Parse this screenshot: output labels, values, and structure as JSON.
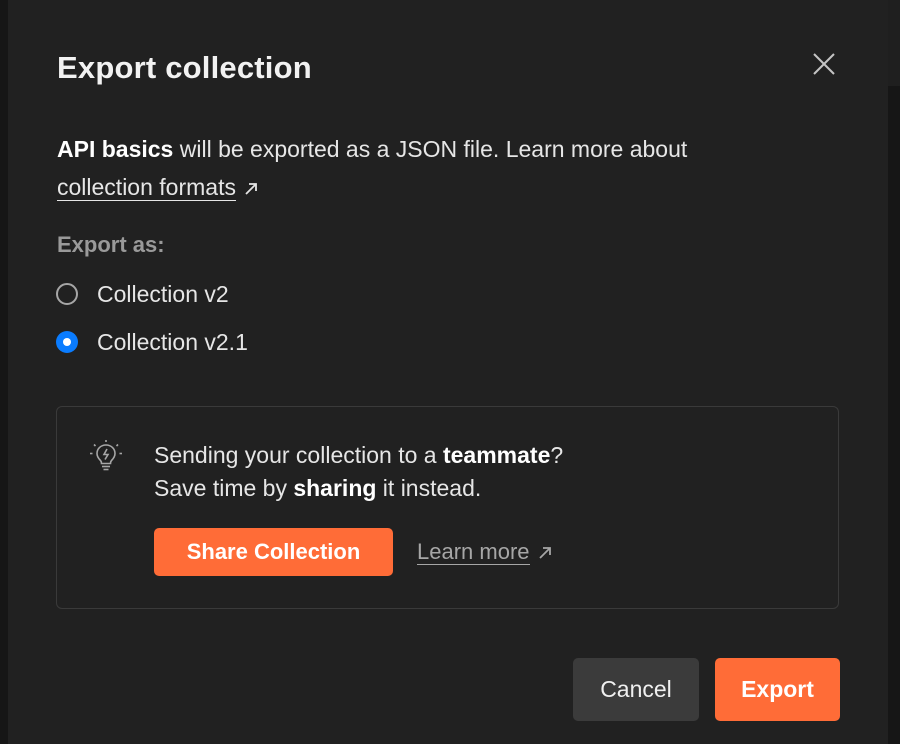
{
  "dialog": {
    "title": "Export collection",
    "close_icon": "close-icon"
  },
  "description": {
    "collection_name": "API basics",
    "text": " will be exported as a JSON file. Learn more about",
    "link_label": "collection formats",
    "link_icon": "external-link-arrow-icon"
  },
  "export_as": {
    "label": "Export as:",
    "options": [
      {
        "label": "Collection v2",
        "selected": false
      },
      {
        "label": "Collection v2.1",
        "selected": true
      }
    ]
  },
  "tip": {
    "icon": "lightbulb-icon",
    "line1_prefix": "Sending your collection to a ",
    "line1_bold": "teammate",
    "line1_suffix": "?",
    "line2_prefix": "Save time by ",
    "line2_bold": "sharing",
    "line2_suffix": " it instead.",
    "share_button": "Share Collection",
    "learn_more": "Learn more"
  },
  "footer": {
    "cancel_label": "Cancel",
    "export_label": "Export"
  },
  "colors": {
    "accent_orange": "#ff6c37",
    "radio_blue": "#0a7cff",
    "dialog_bg": "#212121"
  }
}
